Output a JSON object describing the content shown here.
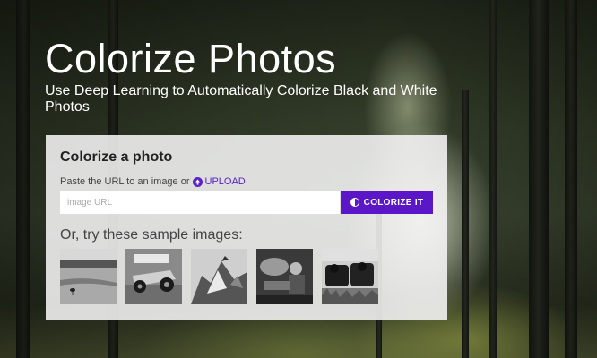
{
  "hero": {
    "title": "Colorize Photos",
    "subtitle": "Use Deep Learning to Automatically Colorize Black and White Photos"
  },
  "panel": {
    "title": "Colorize a photo",
    "hint_text": "Paste the URL to an image or",
    "upload_label": "UPLOAD",
    "upload_icon": "arrow-up-circle-icon",
    "input_placeholder": "image URL",
    "input_value": "",
    "button_label": "COLORIZE IT",
    "button_icon": "half-circle-icon",
    "samples_heading": "Or, try these sample images:",
    "samples": [
      {
        "subject": "beach-bird"
      },
      {
        "subject": "race-car"
      },
      {
        "subject": "mountain-climber"
      },
      {
        "subject": "soldiers"
      },
      {
        "subject": "cows"
      }
    ]
  },
  "colors": {
    "accent": "#5b16c7",
    "panel_bg": "#f6f6f6",
    "text": "#222222"
  }
}
